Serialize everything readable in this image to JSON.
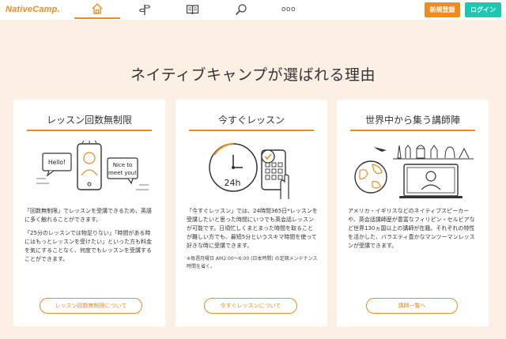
{
  "header": {
    "logo": "NativeCamp.",
    "nav": [
      {
        "icon": "home-icon",
        "active": true
      },
      {
        "icon": "signpost-icon",
        "active": false
      },
      {
        "icon": "book-icon",
        "active": false
      },
      {
        "icon": "search-icon",
        "active": false
      },
      {
        "icon": "more-icon",
        "active": false
      }
    ],
    "more_label": "ooo",
    "signup_label": "新規登録",
    "login_label": "ログイン"
  },
  "main": {
    "heading": "ネイティブキャンプが選ばれる理由",
    "cards": [
      {
        "title": "レッスン回数無制限",
        "bubble_hello": "Hello!",
        "bubble_nice_1": "Nice to",
        "bubble_nice_2": "meet you!",
        "paragraphs": [
          "「回数無制限」でレッスンを受講できるため、英語に多く触れることができます。",
          "「25分のレッスンでは物足りない」「時間がある時にはもっとレッスンを受けたい」といった方も料金を気にすることなく、何度でもレッスンを受講することができます。"
        ],
        "button": "レッスン回数無制限について"
      },
      {
        "title": "今すぐレッスン",
        "clock_label": "24h",
        "paragraphs": [
          "「今すぐレッスン」では、24時間365日*レッスンを受講したいと思った時間にいつでも英会話レッスンが可能です。日頃忙しくまとまった時間を取ることが難しい方でも、最短5分というスキマ時間を使って好きな時に受講できます。"
        ],
        "note": "※毎週月曜日 AM2:00〜6:00 (日本時間) の定期メンテナンス時間を省く。",
        "button": "今すぐレッスンについて"
      },
      {
        "title": "世界中から集う講師陣",
        "paragraphs": [
          "アメリカ・イギリスなどのネイティブスピーカーや、英会話講師歴が豊富なフィリピン・セルビアなど世界130ヵ国以上の講師が在籍。それぞれの特性を活かした、バラエティ豊かなマンツーマンレッスンが受講できます。"
        ],
        "button": "講師一覧へ"
      }
    ]
  },
  "colors": {
    "accent": "#f08c1e",
    "login": "#1dc8b3",
    "background": "#fcefe3"
  }
}
